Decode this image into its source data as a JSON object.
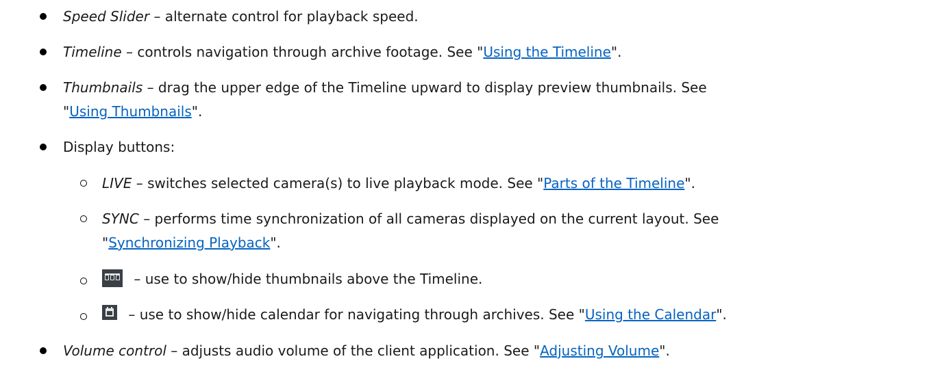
{
  "colors": {
    "text": "#1a1a1a",
    "link": "#0563c1",
    "icon_bg": "#3a3f45"
  },
  "items": [
    {
      "term": "Speed Slider",
      "desc": " – alternate control for playback speed."
    },
    {
      "term": "Timeline",
      "desc": " – controls navigation through archive footage. See \"",
      "link": "Using the Timeline",
      "after": "\"."
    },
    {
      "term": "Thumbnails",
      "desc": " – drag the upper edge of the Timeline upward to display preview thumbnails. See",
      "line2_before": "\"",
      "link": "Using Thumbnails",
      "after": "\"."
    },
    {
      "label": "Display buttons:",
      "subitems": [
        {
          "term": "LIVE",
          "desc": " – switches selected camera(s) to live playback mode. See \"",
          "link": "Parts of the Timeline",
          "after": "\"."
        },
        {
          "term": "SYNC",
          "desc": " – performs time synchronization of all cameras displayed on the current layout. See",
          "line2_before": "\"",
          "link": "Synchronizing Playback",
          "after": "\"."
        },
        {
          "icon": "thumbnails-icon",
          "desc": " – use to show/hide thumbnails above the Timeline."
        },
        {
          "icon": "calendar-icon",
          "desc": " – use to show/hide calendar for navigating through archives. See \"",
          "link": "Using the Calendar",
          "after": "\"."
        }
      ]
    },
    {
      "term": "Volume control",
      "desc": " – adjusts audio volume of the client application. See \"",
      "link": "Adjusting Volume",
      "after": "\"."
    }
  ]
}
